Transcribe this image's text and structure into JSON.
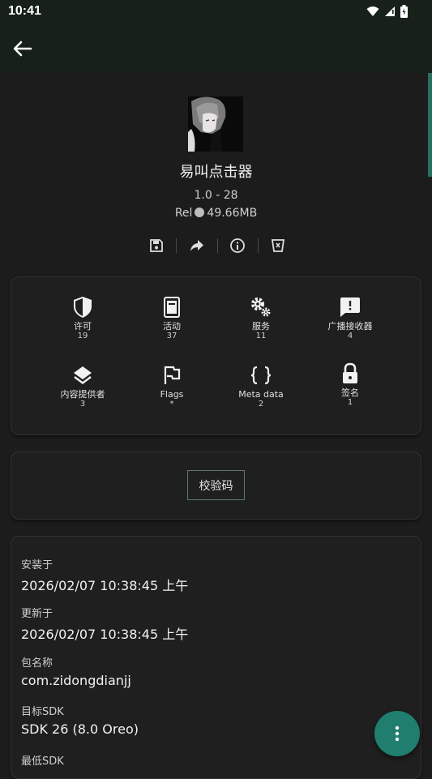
{
  "status_bar": {
    "time": "10:41"
  },
  "app": {
    "name": "易叫点击器",
    "version": "1.0 - 28",
    "release_prefix": "Rel",
    "size": "49.66MB"
  },
  "components": [
    {
      "label": "许可",
      "count": "19",
      "icon": "shield-icon"
    },
    {
      "label": "活动",
      "count": "37",
      "icon": "activity-icon"
    },
    {
      "label": "服务",
      "count": "11",
      "icon": "gears-icon"
    },
    {
      "label": "广播接收器",
      "count": "4",
      "icon": "broadcast-icon"
    },
    {
      "label": "内容提供者",
      "count": "3",
      "icon": "layers-icon"
    },
    {
      "label": "Flags",
      "count": "*",
      "icon": "flag-icon"
    },
    {
      "label": "Meta data",
      "count": "2",
      "icon": "braces-icon"
    },
    {
      "label": "签名",
      "count": "1",
      "icon": "lock-icon"
    }
  ],
  "checksum_label": "校验码",
  "info": {
    "installed_label": "安装于",
    "installed_value": "2026/02/07 10:38:45 上午",
    "updated_label": "更新于",
    "updated_value": "2026/02/07 10:38:45 上午",
    "package_label": "包名称",
    "package_value": "com.zidongdianjj",
    "target_sdk_label": "目标SDK",
    "target_sdk_value": "SDK 26 (8.0 Oreo)",
    "min_sdk_label": "最低SDK"
  },
  "colors": {
    "accent": "#1f7e6e",
    "appbar": "#17211a",
    "background": "#1c1c1c"
  }
}
